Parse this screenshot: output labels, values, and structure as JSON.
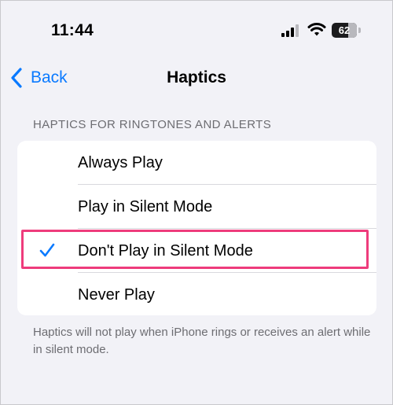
{
  "status_bar": {
    "time": "11:44",
    "signal_icon": "cellular-signal-icon",
    "wifi_icon": "wifi-icon",
    "battery_level": "62"
  },
  "nav": {
    "back_label": "Back",
    "back_icon": "chevron-left-icon",
    "title": "Haptics"
  },
  "section": {
    "header": "HAPTICS FOR RINGTONES AND ALERTS",
    "options": [
      {
        "label": "Always Play",
        "selected": false
      },
      {
        "label": "Play in Silent Mode",
        "selected": false
      },
      {
        "label": "Don't Play in Silent Mode",
        "selected": true
      },
      {
        "label": "Never Play",
        "selected": false
      }
    ],
    "footer": "Haptics will not play when iPhone rings or receives an alert while in silent mode."
  },
  "colors": {
    "accent": "#0a7aff",
    "highlight": "#ee3c7c",
    "background": "#f2f2f7"
  }
}
